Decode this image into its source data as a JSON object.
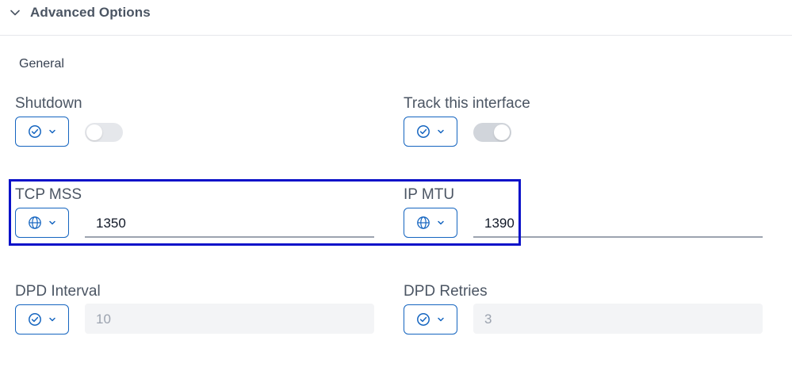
{
  "header": {
    "title": "Advanced Options",
    "chevron_icon": "chevron-down-icon"
  },
  "section": {
    "title": "General"
  },
  "fields": {
    "shutdown": {
      "label": "Shutdown",
      "scope_icon": "check-circle-icon",
      "toggle_on": false
    },
    "track_interface": {
      "label": "Track this interface",
      "scope_icon": "check-circle-icon",
      "toggle_on": true
    },
    "tcp_mss": {
      "label": "TCP MSS",
      "scope_icon": "globe-icon",
      "value": "1350"
    },
    "ip_mtu": {
      "label": "IP MTU",
      "scope_icon": "globe-icon",
      "value": "1390"
    },
    "dpd_interval": {
      "label": "DPD Interval",
      "scope_icon": "check-circle-icon",
      "value": "10"
    },
    "dpd_retries": {
      "label": "DPD Retries",
      "scope_icon": "check-circle-icon",
      "value": "3"
    }
  },
  "colors": {
    "accent": "#1565c0",
    "highlight": "#0b12c9"
  }
}
